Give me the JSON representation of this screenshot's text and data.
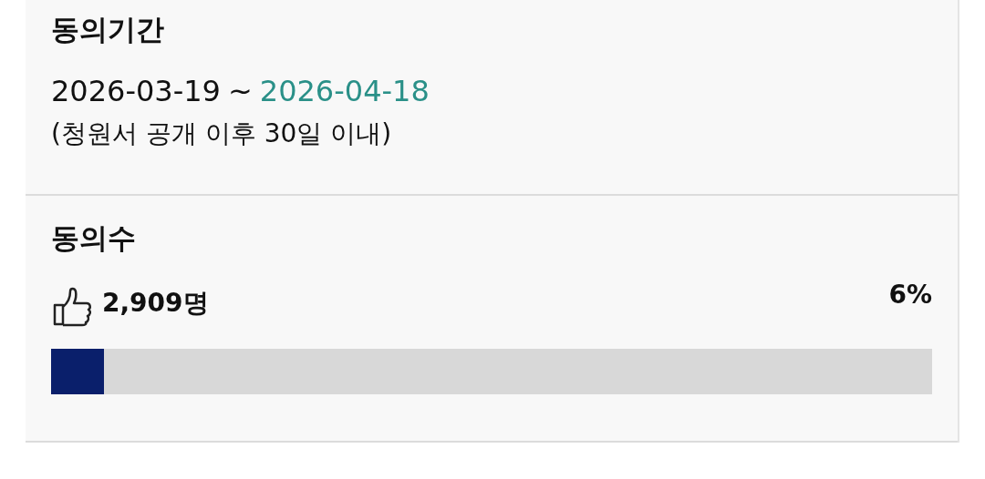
{
  "sections": [
    {
      "kind": "period",
      "title": "동의기간",
      "start": "2026-03-19",
      "separator": "~",
      "end": "2026-04-18",
      "note": "(청원서 공개 이후 30일 이내)"
    },
    {
      "kind": "count",
      "title": "동의수",
      "count": "2,909명",
      "percent": "6%",
      "level": 0.06
    }
  ]
}
